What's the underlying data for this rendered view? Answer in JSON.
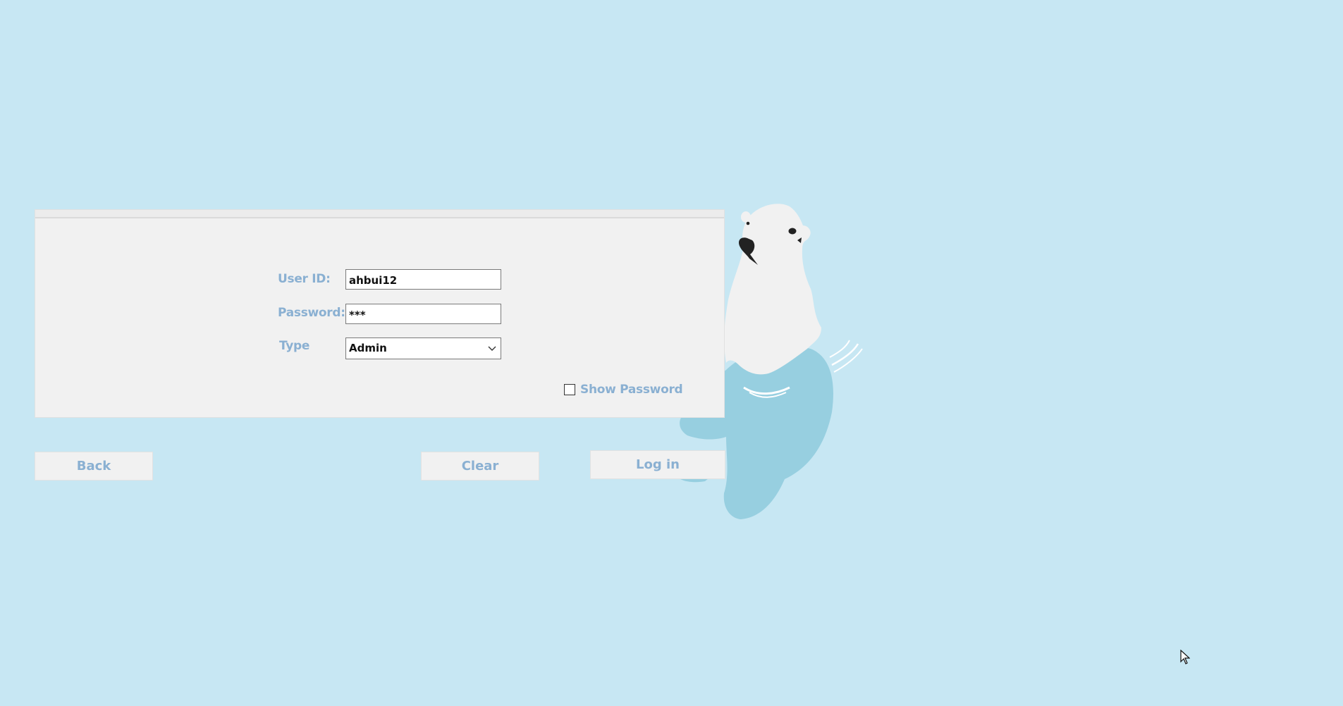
{
  "form": {
    "user_id_label": "User ID:",
    "user_id_value": "ahbui12",
    "password_label": "Password:",
    "password_value": "***",
    "type_label": "Type",
    "type_value": "Admin",
    "show_password_label": "Show Password",
    "show_password_checked": false
  },
  "buttons": {
    "back": "Back",
    "clear": "Clear",
    "login": "Log in"
  },
  "colors": {
    "background": "#c7e7f3",
    "panel": "#f1f1f1",
    "label_text": "#8ab0d2",
    "water": "#97cfe0",
    "bear": "#f1f1f1"
  },
  "icons": {
    "dropdown": "chevron-down-icon",
    "mascot": "polar-bear-illustration",
    "cursor": "mouse-pointer-icon"
  }
}
